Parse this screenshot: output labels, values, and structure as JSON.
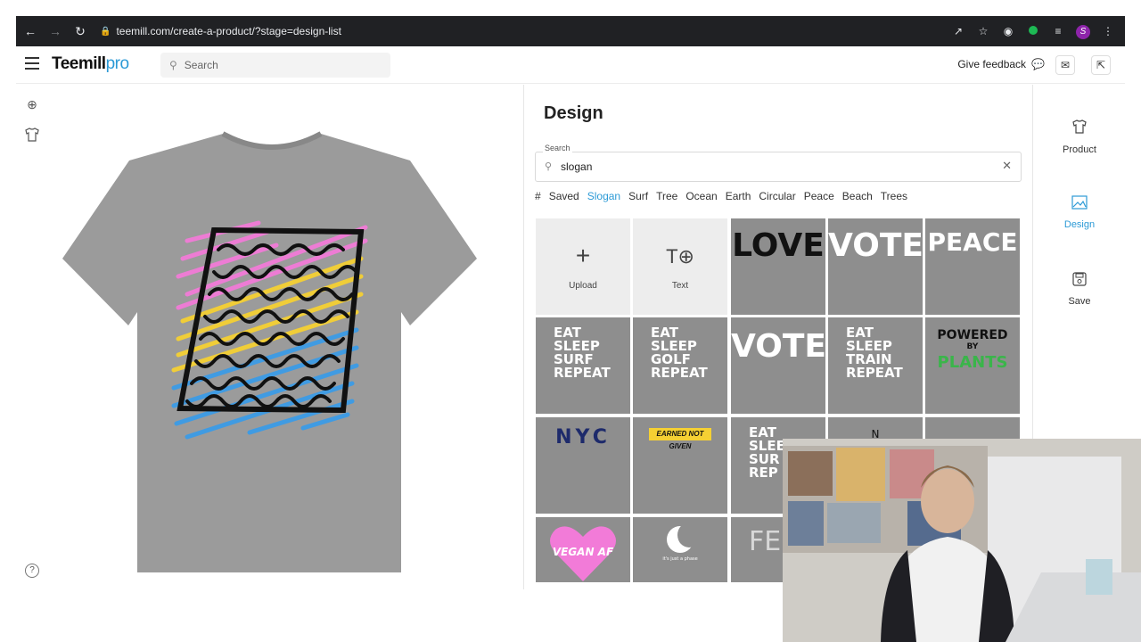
{
  "browser": {
    "url": "teemill.com/create-a-product/?stage=design-list",
    "profile_initial": "S"
  },
  "header": {
    "logo_main": "Teemill",
    "logo_pro": "pro",
    "search_placeholder": "Search",
    "feedback_label": "Give feedback"
  },
  "design_panel": {
    "title": "Design",
    "search_label": "Search",
    "search_value": "slogan",
    "tags": [
      "#",
      "Saved",
      "Slogan",
      "Surf",
      "Tree",
      "Ocean",
      "Earth",
      "Circular",
      "Peace",
      "Beach",
      "Trees"
    ],
    "active_tag": "Slogan",
    "tiles": {
      "upload": "Upload",
      "text": "Text",
      "love": "LOVE",
      "vote1": "VOTE",
      "peace": "PEACE",
      "surf": [
        "EAT",
        "SLEEP",
        "SURF",
        "REPEAT"
      ],
      "golf": [
        "EAT",
        "SLEEP",
        "GOLF",
        "REPEAT"
      ],
      "vote2": "VOTE",
      "train": [
        "EAT",
        "SLEEP",
        "TRAIN",
        "REPEAT"
      ],
      "powered": [
        "POWERED",
        "BY",
        "PLANTS"
      ],
      "nyc": "NYC",
      "earned": "EARNED NOT GIVEN",
      "surf2": [
        "EAT",
        "SLEE",
        "SUR",
        "REP"
      ],
      "n_partial": "N",
      "vegan": "VEGAN AF",
      "moon_caption": "it's just a phase",
      "femi": "FEMI"
    }
  },
  "right_nav": {
    "items": [
      {
        "label": "Product",
        "icon": "tshirt-icon"
      },
      {
        "label": "Design",
        "icon": "image-icon"
      },
      {
        "label": "Save",
        "icon": "save-icon"
      }
    ],
    "active": "Design"
  },
  "colors": {
    "accent": "#2c9ad6",
    "tile_gray": "#8e8e8e",
    "tshirt_gray": "#9a9a9a",
    "pink": "#f27bd8",
    "yellow": "#f5d033",
    "blue": "#3c9be6"
  }
}
